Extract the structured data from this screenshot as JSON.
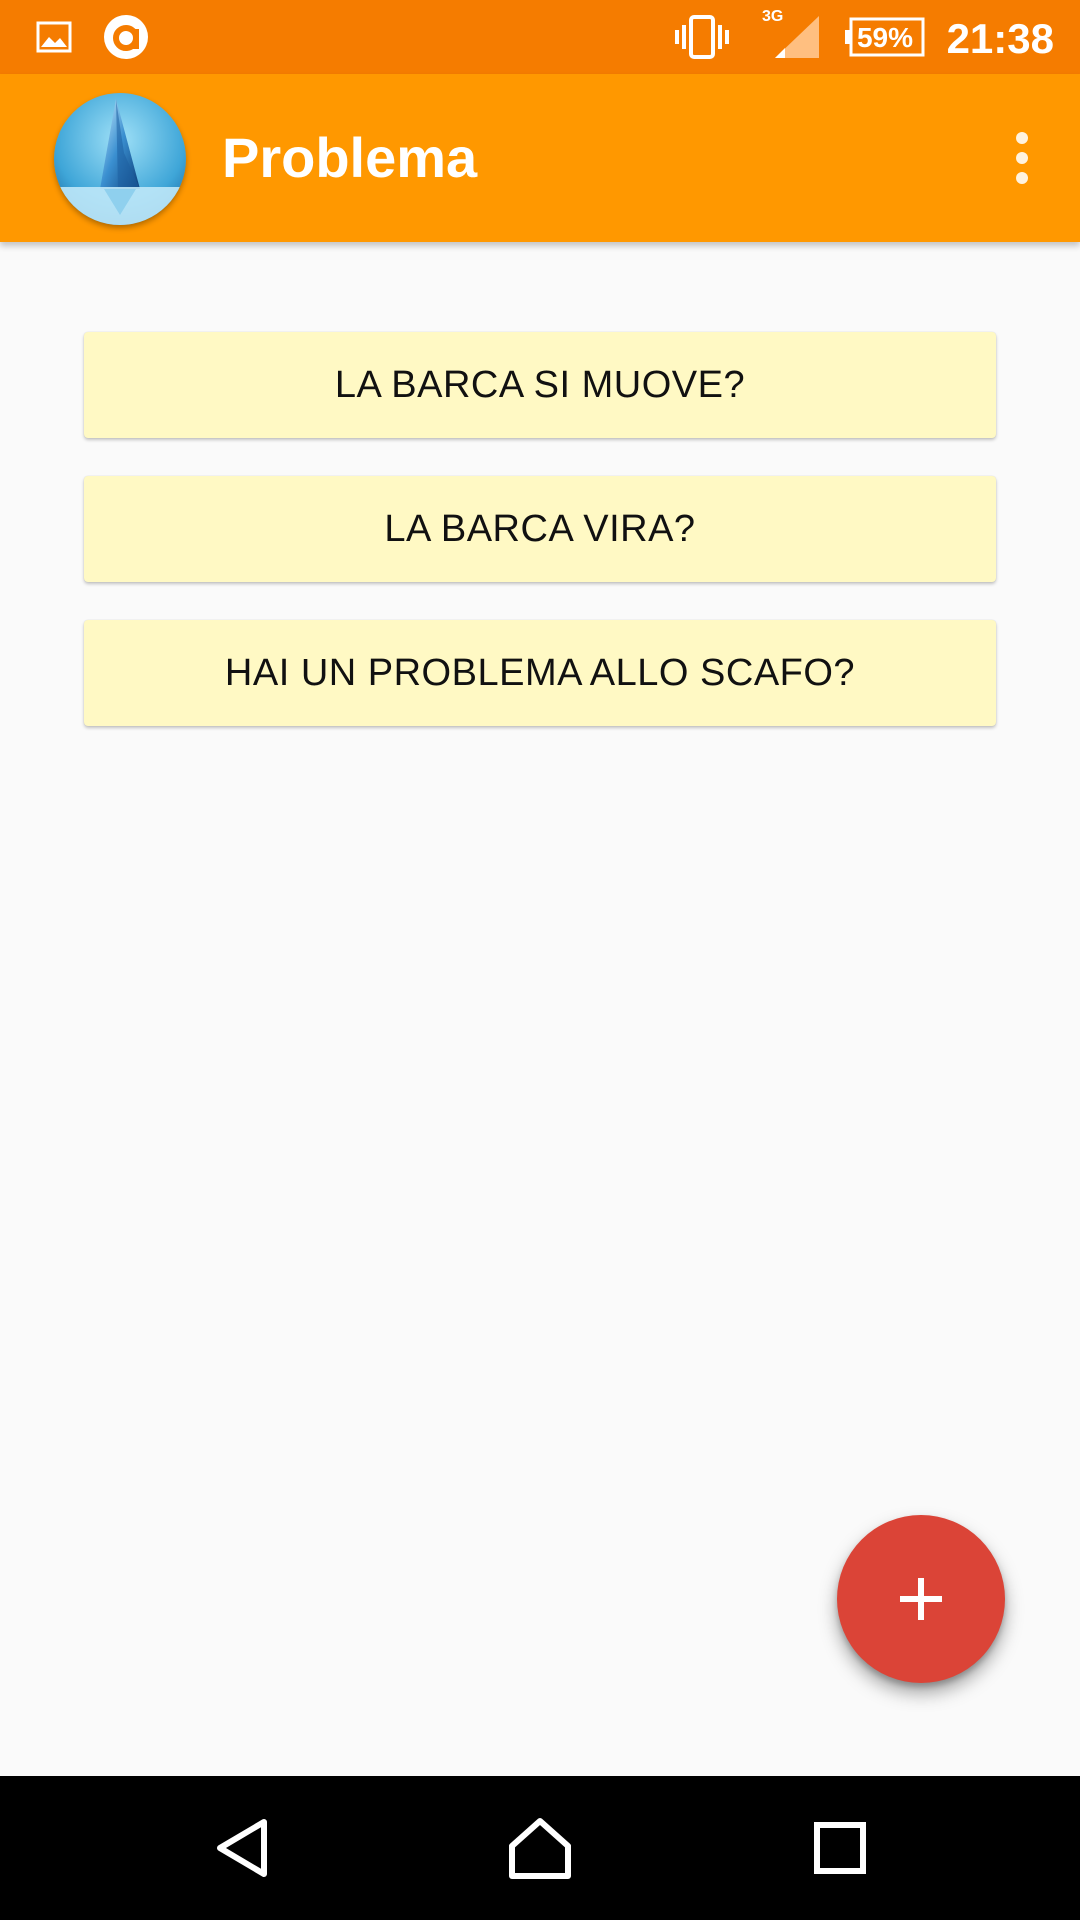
{
  "status_bar": {
    "time": "21:38",
    "battery": "59%",
    "network": "3G",
    "icons": [
      "gallery-icon",
      "app-notification-icon",
      "vibrate-icon",
      "signal-icon",
      "battery-icon"
    ]
  },
  "app_bar": {
    "title": "Problema",
    "logo": "iceberg-logo",
    "menu_icon": "overflow-menu-icon"
  },
  "options": [
    {
      "label": "LA BARCA SI MUOVE?"
    },
    {
      "label": "LA BARCA VIRA?"
    },
    {
      "label": "HAI UN PROBLEMA ALLO SCAFO?"
    }
  ],
  "fab": {
    "icon": "plus-icon"
  },
  "nav_bar": {
    "icons": [
      "back-icon",
      "home-icon",
      "recents-icon"
    ]
  },
  "colors": {
    "status_bar": "#f57c00",
    "app_bar": "#ff9800",
    "option_bg": "#fff9c4",
    "fab": "#db4437",
    "background": "#fafafa"
  }
}
